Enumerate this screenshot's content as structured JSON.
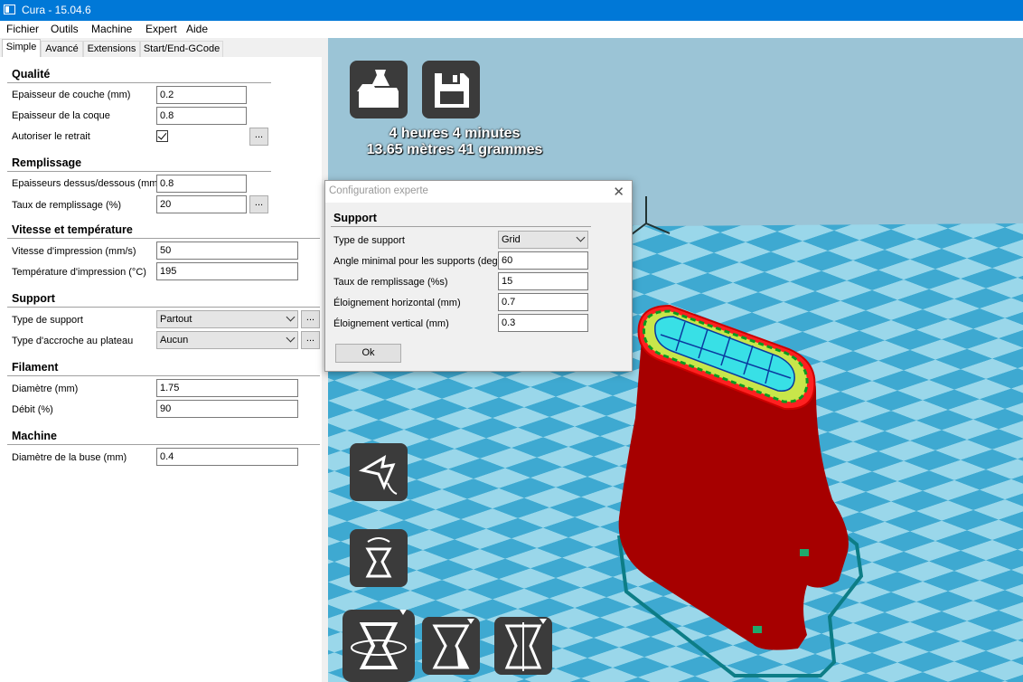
{
  "window": {
    "title": "Cura - 15.04.6"
  },
  "menu": [
    "Fichier",
    "Outils",
    "Machine",
    "Expert",
    "Aide"
  ],
  "tabs": [
    "Simple",
    "Avancé",
    "Extensions",
    "Start/End-GCode"
  ],
  "panel": {
    "quality": {
      "title": "Qualité",
      "layer_height_label": "Epaisseur de couche (mm)",
      "layer_height": "0.2",
      "shell_label": "Epaisseur de la coque",
      "shell": "0.8",
      "retraction_label": "Autoriser le retrait"
    },
    "fill": {
      "title": "Remplissage",
      "topbottom_label": "Epaisseurs dessus/dessous (mm)",
      "topbottom": "0.8",
      "density_label": "Taux de remplissage (%)",
      "density": "20"
    },
    "speed": {
      "title": "Vitesse et température",
      "speed_label": "Vitesse d'impression (mm/s)",
      "speed": "50",
      "temp_label": "Température d'impression (°C)",
      "temp": "195"
    },
    "support": {
      "title": "Support",
      "type_label": "Type de support",
      "type": "Partout",
      "adhesion_label": "Type d'accroche au plateau",
      "adhesion": "Aucun"
    },
    "filament": {
      "title": "Filament",
      "diameter_label": "Diamètre (mm)",
      "diameter": "1.75",
      "flow_label": "Débit (%)",
      "flow": "90"
    },
    "machine": {
      "title": "Machine",
      "nozzle_label": "Diamètre de la buse (mm)",
      "nozzle": "0.4"
    },
    "more_label": "..."
  },
  "viewport": {
    "print_time": "4 heures 4 minutes",
    "material": "13.65 mètres 41 grammes"
  },
  "dialog": {
    "title": "Configuration experte",
    "close": "✕",
    "section": "Support",
    "type_label": "Type de support",
    "type": "Grid",
    "angle_label": "Angle minimal pour les supports (deg)",
    "angle": "60",
    "fill_label": "Taux de remplissage (%s)",
    "fill": "15",
    "xy_label": "Éloignement horizontal (mm)",
    "xy": "0.7",
    "z_label": "Éloignement vertical (mm)",
    "z": "0.3",
    "ok": "Ok"
  },
  "colors": {
    "titlebar": "#0078d7",
    "bed_light": "#a5e0f0",
    "bed_dark": "#3aa8d0",
    "model": "#a60000",
    "bg": "#87b8ce"
  }
}
